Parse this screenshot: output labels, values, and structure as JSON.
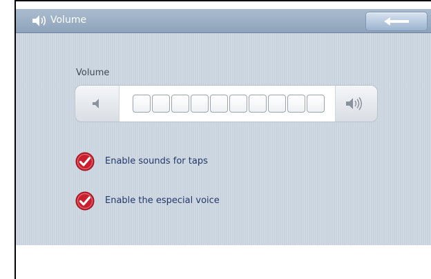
{
  "window": {
    "title": "Volume",
    "title_icon": "speaker-icon",
    "back_icon": "arrow-left-icon"
  },
  "volume": {
    "label": "Volume",
    "decrease_icon": "speaker-low-icon",
    "increase_icon": "speaker-high-icon",
    "segment_count": 10,
    "level": 0
  },
  "options": [
    {
      "label": "Enable sounds for taps",
      "checked": true
    },
    {
      "label": "Enable the especial voice",
      "checked": true
    }
  ],
  "colors": {
    "titlebar": "#9fb2c8",
    "background": "#c9d3de",
    "check_red": "#c8202f",
    "label_text": "#22386a"
  }
}
